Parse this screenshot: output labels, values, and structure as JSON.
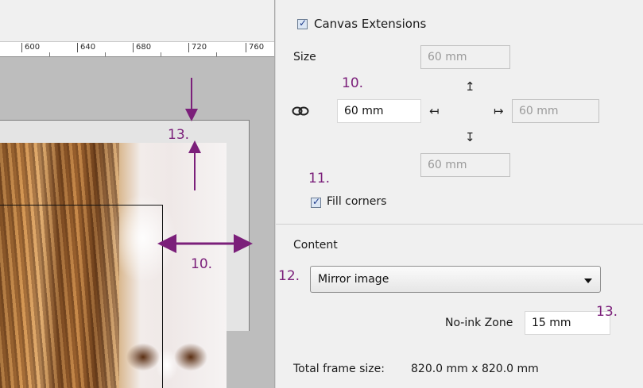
{
  "ruler": {
    "labels": [
      "600",
      "640",
      "680",
      "720",
      "760"
    ]
  },
  "panel": {
    "canvas_extensions_label": "Canvas Extensions",
    "canvas_extensions_checked": true,
    "size_label": "Size",
    "top_value": "60 mm",
    "left_value": "60 mm",
    "right_value": "60 mm",
    "bottom_value": "60 mm",
    "fill_corners_label": "Fill corners",
    "fill_corners_checked": true,
    "content_label": "Content",
    "content_selected": "Mirror image",
    "no_ink_zone_label": "No-ink Zone",
    "no_ink_zone_value": "15 mm",
    "total_frame_label": "Total frame size:",
    "total_frame_value": "820.0 mm x 820.0 mm"
  },
  "annotations": {
    "n10_panel": "10.",
    "n11": "11.",
    "n12": "12.",
    "n13_panel": "13.",
    "n13_canvas": "13.",
    "n10_canvas": "10."
  },
  "icons": {
    "link": "chain-link-icon",
    "up": "arrow-up-bar-icon",
    "down": "arrow-down-bar-icon",
    "left": "arrow-left-bar-icon",
    "right": "arrow-right-bar-icon"
  },
  "colors": {
    "annotation": "#7b1f7a",
    "checkbox_fill": "#dbe6f4"
  }
}
